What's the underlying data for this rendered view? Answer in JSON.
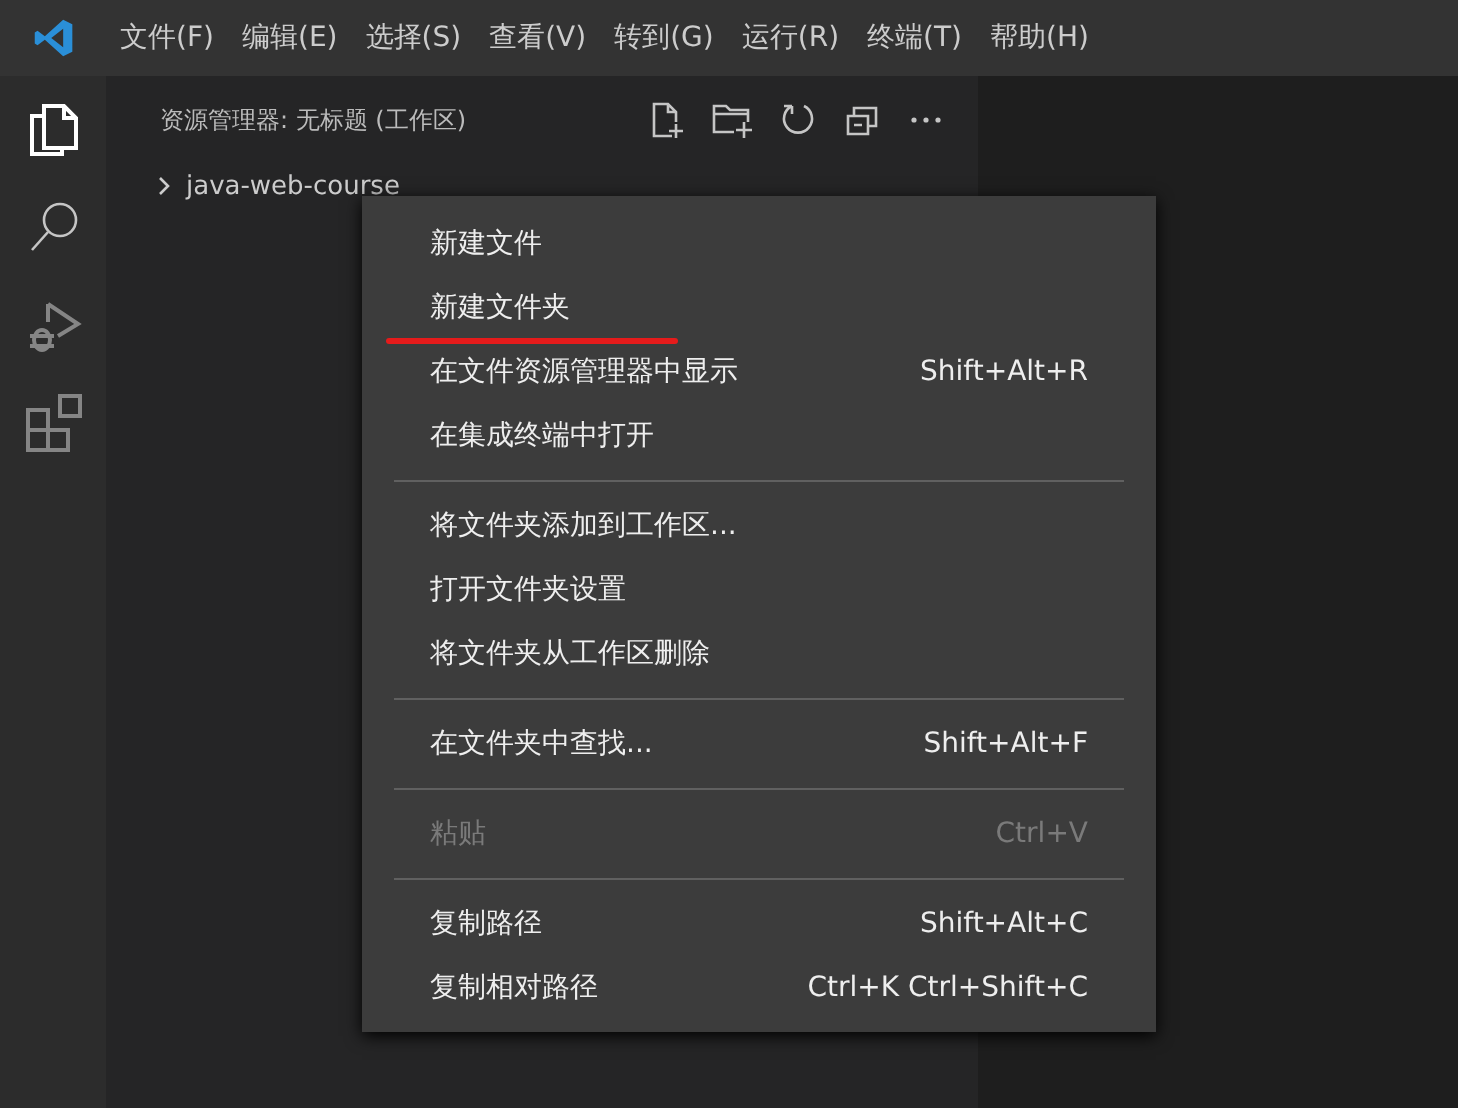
{
  "menubar": {
    "items": [
      "文件(F)",
      "编辑(E)",
      "选择(S)",
      "查看(V)",
      "转到(G)",
      "运行(R)",
      "终端(T)",
      "帮助(H)"
    ]
  },
  "explorer": {
    "title": "资源管理器: 无标题 (工作区)",
    "tree": [
      {
        "label": "java-web-course",
        "expanded": false
      }
    ]
  },
  "context_menu": {
    "items": [
      {
        "kind": "item",
        "label": "新建文件",
        "disabled": false,
        "marked": false
      },
      {
        "kind": "item",
        "label": "新建文件夹",
        "disabled": false,
        "marked": true
      },
      {
        "kind": "item",
        "label": "在文件资源管理器中显示",
        "shortcut": "Shift+Alt+R",
        "disabled": false,
        "marked": false
      },
      {
        "kind": "item",
        "label": "在集成终端中打开",
        "disabled": false,
        "marked": false
      },
      {
        "kind": "separator"
      },
      {
        "kind": "item",
        "label": "将文件夹添加到工作区...",
        "disabled": false,
        "marked": false
      },
      {
        "kind": "item",
        "label": "打开文件夹设置",
        "disabled": false,
        "marked": false
      },
      {
        "kind": "item",
        "label": "将文件夹从工作区删除",
        "disabled": false,
        "marked": false
      },
      {
        "kind": "separator"
      },
      {
        "kind": "item",
        "label": "在文件夹中查找...",
        "shortcut": "Shift+Alt+F",
        "disabled": false,
        "marked": false
      },
      {
        "kind": "separator"
      },
      {
        "kind": "item",
        "label": "粘贴",
        "shortcut": "Ctrl+V",
        "disabled": true,
        "marked": false
      },
      {
        "kind": "separator"
      },
      {
        "kind": "item",
        "label": "复制路径",
        "shortcut": "Shift+Alt+C",
        "disabled": false,
        "marked": false
      },
      {
        "kind": "item",
        "label": "复制相对路径",
        "shortcut": "Ctrl+K Ctrl+Shift+C",
        "disabled": false,
        "marked": false
      }
    ]
  }
}
